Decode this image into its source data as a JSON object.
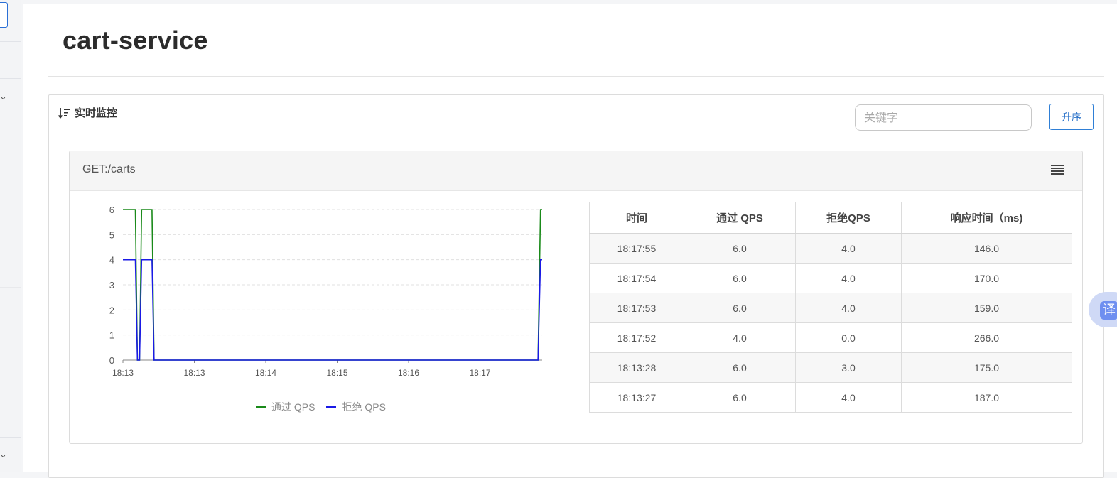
{
  "page": {
    "title": "cart-service"
  },
  "panel": {
    "heading": "实时监控",
    "search": {
      "placeholder": "关键字",
      "value": ""
    },
    "sort_label": "升序"
  },
  "card": {
    "title": "GET:/carts"
  },
  "legend": [
    {
      "label": "通过 QPS",
      "color": "#1a8a1a"
    },
    {
      "label": "拒绝 QPS",
      "color": "#1a1ae6"
    }
  ],
  "chart_data": {
    "type": "line",
    "x_ticks": [
      "18:13",
      "18:13",
      "18:14",
      "18:15",
      "18:16",
      "18:17"
    ],
    "ylim": [
      0,
      6
    ],
    "y_ticks": [
      0,
      1,
      2,
      3,
      4,
      5,
      6
    ],
    "grid": true,
    "legend_position": "bottom",
    "series": [
      {
        "name": "通过 QPS",
        "color": "#1a8a1a",
        "points": [
          [
            0,
            6
          ],
          [
            3,
            6
          ],
          [
            3.5,
            0
          ],
          [
            4,
            0
          ],
          [
            4.5,
            6
          ],
          [
            7,
            6
          ],
          [
            7.5,
            0
          ],
          [
            100,
            0
          ],
          [
            100.6,
            6
          ],
          [
            101,
            6
          ]
        ]
      },
      {
        "name": "拒绝 QPS",
        "color": "#1a1ae6",
        "points": [
          [
            0,
            4
          ],
          [
            3,
            4
          ],
          [
            3.5,
            0
          ],
          [
            4,
            0
          ],
          [
            4.5,
            4
          ],
          [
            7,
            4
          ],
          [
            7.5,
            0
          ],
          [
            100,
            0
          ],
          [
            100.6,
            4
          ],
          [
            101,
            4
          ]
        ]
      }
    ]
  },
  "table": {
    "headers": [
      "时间",
      "通过 QPS",
      "拒绝QPS",
      "响应时间（ms)"
    ],
    "rows": [
      [
        "18:17:55",
        "6.0",
        "4.0",
        "146.0"
      ],
      [
        "18:17:54",
        "6.0",
        "4.0",
        "170.0"
      ],
      [
        "18:17:53",
        "6.0",
        "4.0",
        "159.0"
      ],
      [
        "18:17:52",
        "4.0",
        "0.0",
        "266.0"
      ],
      [
        "18:13:28",
        "6.0",
        "3.0",
        "175.0"
      ],
      [
        "18:13:27",
        "6.0",
        "4.0",
        "187.0"
      ]
    ]
  },
  "fab": {
    "label": "译"
  }
}
